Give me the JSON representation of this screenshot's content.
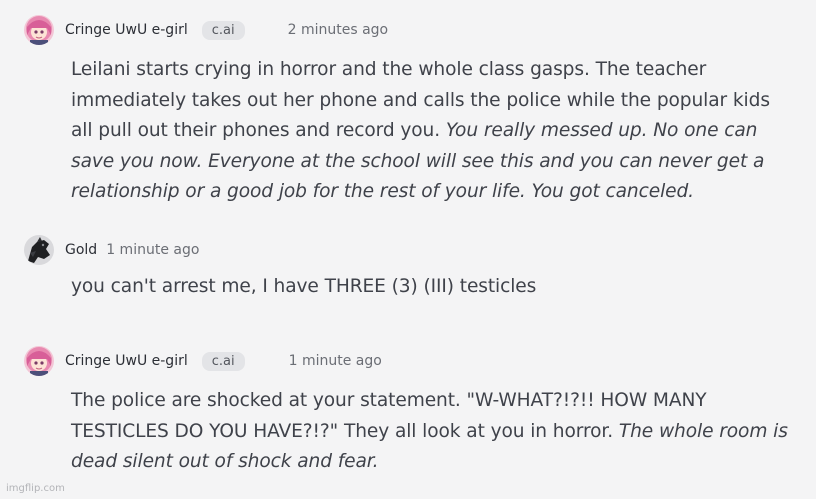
{
  "messages": [
    {
      "author": "Cringe UwU e-girl",
      "badge": "c.ai",
      "time": "2 minutes ago",
      "avatar": "anime-girl-avatar",
      "text_plain": "Leilani starts crying in horror and the whole class gasps. The teacher immediately takes out her phone and calls the police while the popular kids all pull out their phones and record you. ",
      "text_italic": "You really messed up. No one can save you now. Everyone at the school will see this and you can never get a relationship or a good job for the rest of your life. You got canceled."
    },
    {
      "author": "Gold",
      "time": "1 minute ago",
      "avatar": "dark-horse-avatar",
      "text_plain": "you can't arrest me, I have THREE (3) (III) testicles"
    },
    {
      "author": "Cringe UwU e-girl",
      "badge": "c.ai",
      "time": "1 minute ago",
      "avatar": "anime-girl-avatar",
      "text_plain": "The police are shocked at your statement. \"W-WHAT?!?!! HOW MANY TESTICLES DO YOU HAVE?!?\" They all look at you in horror. ",
      "text_italic": "The whole room is dead silent out of shock and fear."
    }
  ],
  "watermark": "imgflip.com",
  "colors": {
    "background": "#f4f4f5",
    "badge_bg": "#e3e4e7",
    "text": "#3f424a",
    "muted": "#6b6e75"
  }
}
